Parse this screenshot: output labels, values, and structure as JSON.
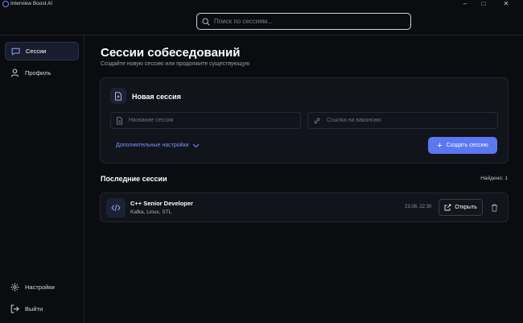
{
  "app": {
    "title": "Interview Boost AI"
  },
  "window_controls": {
    "minimize": "–",
    "maximize": "□",
    "close": "✕"
  },
  "search": {
    "placeholder": "Поиск по сессиям...",
    "value": ""
  },
  "sidebar": {
    "items": [
      {
        "label": "Сессии",
        "icon": "chat-icon",
        "active": true
      },
      {
        "label": "Профиль",
        "icon": "user-icon",
        "active": false
      }
    ],
    "bottom_items": [
      {
        "label": "Настройки",
        "icon": "gear-icon"
      },
      {
        "label": "Выйти",
        "icon": "logout-icon"
      }
    ]
  },
  "main": {
    "title": "Сессии собеседований",
    "subtitle": "Создайте новую сессию или продолжите существующую",
    "new_session": {
      "title": "Новая сессия",
      "name_placeholder": "Название сессии",
      "link_placeholder": "Ссылка на вакансию",
      "advanced_label": "Дополнительные настройки",
      "create_label": "Создать сессию"
    },
    "recent": {
      "title": "Последние сессии",
      "found": "Найдено: 1",
      "sessions": [
        {
          "title": "C++ Senior Developer",
          "tags": "Kafka, Linux, STL",
          "date": "23.08, 22:30",
          "open_label": "Открыть"
        }
      ]
    }
  },
  "colors": {
    "accent": "#5b78f2",
    "background": "#0b0c10",
    "card": "#12141b",
    "link": "#7a92ff"
  }
}
